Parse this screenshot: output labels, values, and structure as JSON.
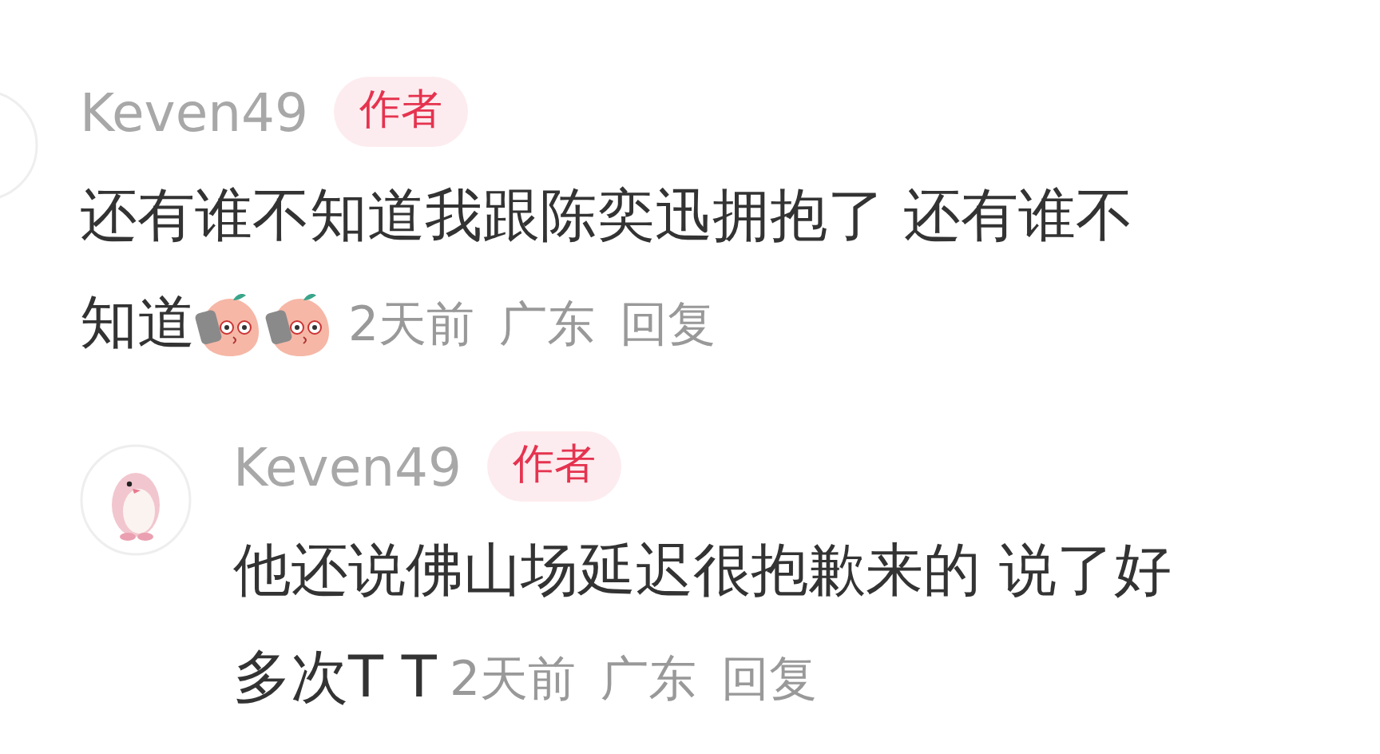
{
  "comments": [
    {
      "author": "Keven49",
      "badge": "作者",
      "text_lines": [
        "还有谁不知道我跟陈奕迅拥抱了 还有谁不",
        "知道"
      ],
      "stickers": [
        {
          "kind": "peach"
        },
        {
          "kind": "peach"
        }
      ],
      "time": "2天前",
      "location": "广东",
      "reply_label": "回复",
      "replies": [
        {
          "author": "Keven49",
          "badge": "作者",
          "text_lines": [
            "他还说佛山场延迟很抱歉来的 说了好",
            "多次T T"
          ],
          "time": "2天前",
          "location": "广东",
          "reply_label": "回复"
        }
      ]
    }
  ]
}
